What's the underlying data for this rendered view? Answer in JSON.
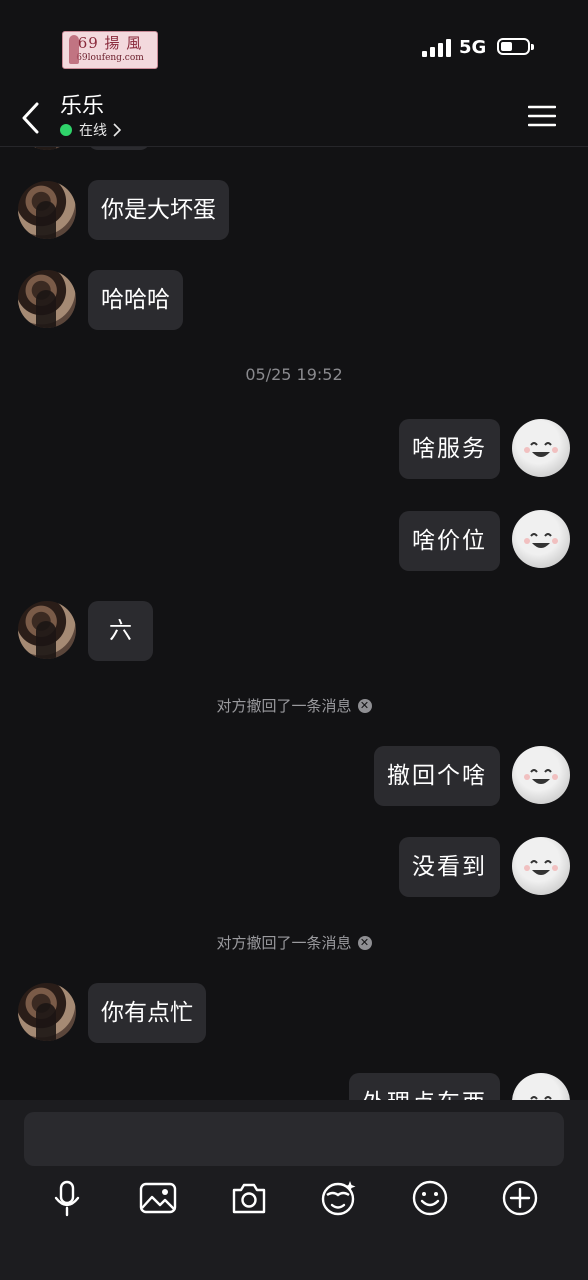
{
  "status_bar": {
    "network": "5G",
    "battery_level": 0.45
  },
  "watermark": {
    "main": "69 揚 風",
    "sub": "69loufeng.com"
  },
  "header": {
    "name": "乐乐",
    "status": "在线"
  },
  "messages": [
    {
      "side": "in",
      "text": "你是大坏蛋"
    },
    {
      "side": "in",
      "text": "哈哈哈"
    },
    {
      "side": "out",
      "text": "啥服务"
    },
    {
      "side": "out",
      "text": "啥价位"
    },
    {
      "side": "in",
      "text": "六"
    },
    {
      "side": "out",
      "text": "撤回个啥"
    },
    {
      "side": "out",
      "text": "没看到"
    },
    {
      "side": "in",
      "text": "你有点忙"
    },
    {
      "side": "out",
      "text": "外理点车西"
    }
  ],
  "timestamp": "05/25 19:52",
  "recalled_notice": "对方撤回了一条消息",
  "composer": {
    "placeholder": "",
    "tools": [
      "microphone-icon",
      "image-icon",
      "camera-icon",
      "sticker-icon",
      "emoji-icon",
      "plus-icon"
    ]
  }
}
